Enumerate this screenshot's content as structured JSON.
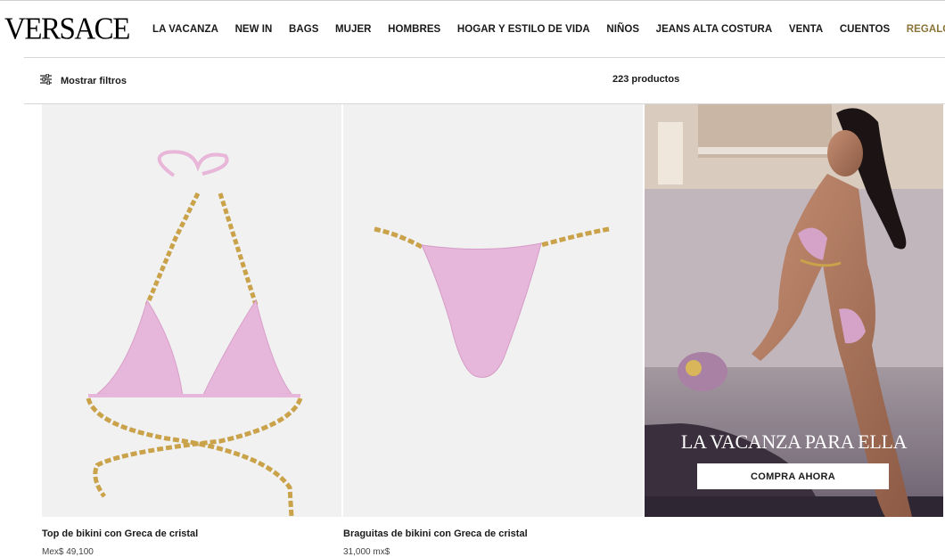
{
  "brand": {
    "logo": "VERSACE"
  },
  "nav": {
    "items": [
      "LA VACANZA",
      "NEW IN",
      "BAGS",
      "MUJER",
      "HOMBRES",
      "HOGAR Y ESTILO DE VIDA",
      "NIÑOS",
      "JEANS ALTA COSTURA",
      "VENTA",
      "CUENTOS",
      "REGALOS"
    ],
    "highlight_color": "#8a7437"
  },
  "filters": {
    "label": "Mostrar filtros",
    "icon": "sliders-icon"
  },
  "results": {
    "count_label": "223 productos"
  },
  "products": [
    {
      "name": "Top de bikini con Greca de cristal",
      "price": "Mex$ 49,100"
    },
    {
      "name": "Braguitas de bikini con Greca de cristal",
      "price": "31,000 mx$"
    }
  ],
  "promo": {
    "title": "LA VACANZA PARA ELLA",
    "cta": "COMPRA AHORA"
  },
  "colors": {
    "accent_gold": "#8a7437",
    "product_pink": "#e7b6db",
    "chain_gold": "#c9a24a"
  }
}
